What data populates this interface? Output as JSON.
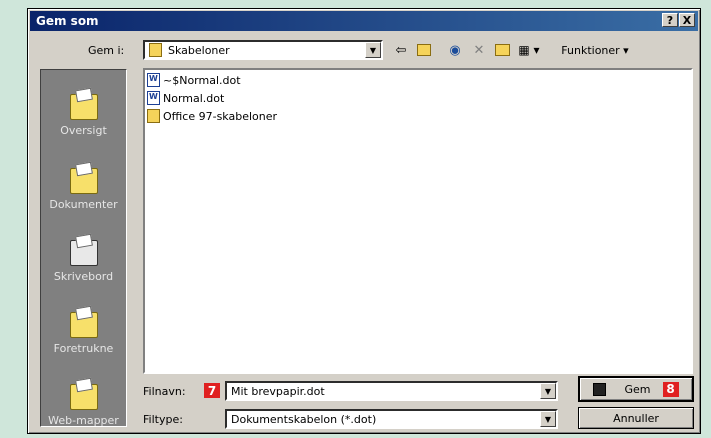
{
  "window": {
    "title": "Gem som",
    "help_btn": "?",
    "close_btn": "X"
  },
  "savein": {
    "label": "Gem i:",
    "value": "Skabeloner"
  },
  "toolbar": {
    "functions_label": "Funktioner"
  },
  "places": [
    {
      "label": "Oversigt"
    },
    {
      "label": "Dokumenter"
    },
    {
      "label": "Skrivebord"
    },
    {
      "label": "Foretrukne"
    },
    {
      "label": "Web-mapper"
    }
  ],
  "files": [
    {
      "name": "~$Normal.dot",
      "type": "doc"
    },
    {
      "name": "Normal.dot",
      "type": "doc"
    },
    {
      "name": "Office 97-skabeloner",
      "type": "folder"
    }
  ],
  "filename": {
    "label": "Filnavn:",
    "value": "Mit brevpapir.dot",
    "badge": "7"
  },
  "filetype": {
    "label": "Filtype:",
    "value": "Dokumentskabelon (*.dot)"
  },
  "buttons": {
    "save": "Gem",
    "save_badge": "8",
    "cancel": "Annuller"
  }
}
